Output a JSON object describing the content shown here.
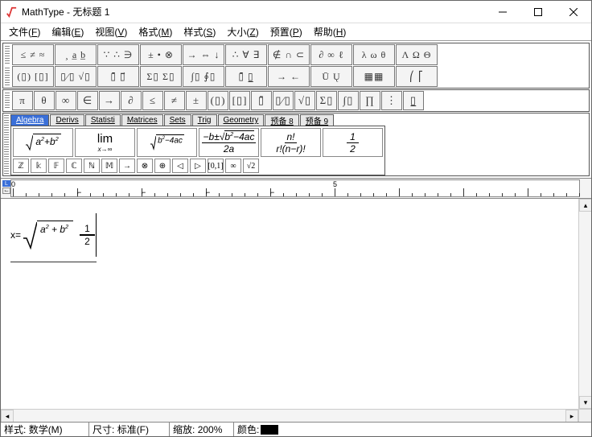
{
  "window": {
    "app": "MathType",
    "title": "无标题 1"
  },
  "menu": [
    {
      "label": "文件",
      "hotkey": "F"
    },
    {
      "label": "编辑",
      "hotkey": "E"
    },
    {
      "label": "视图",
      "hotkey": "V"
    },
    {
      "label": "格式",
      "hotkey": "M"
    },
    {
      "label": "样式",
      "hotkey": "S"
    },
    {
      "label": "大小",
      "hotkey": "Z"
    },
    {
      "label": "预置",
      "hotkey": "P"
    },
    {
      "label": "帮助",
      "hotkey": "H"
    }
  ],
  "palette_row1": [
    "≤ ≠ ≈",
    "¸ a̲ b̲",
    "∵ ∴ ∋",
    "± • ⊗",
    "→ ⇔ ↓",
    "∴ ∀ ∃",
    "∉ ∩ ⊂",
    "∂ ∞ ℓ",
    "λ ω θ",
    "Λ Ω Θ"
  ],
  "palette_row1b": [
    "(▯) [▯]",
    "▯⁄▯ √▯",
    "▯̄ ▯⃗",
    "Σ▯ Σ▯",
    "∫▯ ∮▯",
    "▯̄ ▯̲",
    "→ ←",
    "Ū Ų",
    "▦▦",
    "⎛ ⎡"
  ],
  "palette_row2": [
    "π",
    "θ",
    "∞",
    "∈",
    "→",
    "∂",
    "≤",
    "≠",
    "±",
    "(▯)",
    "[▯]",
    "▯̄",
    "▯⁄▯",
    "√▯",
    "Σ▯",
    "∫▯",
    "∏",
    "⋮",
    "▯̲"
  ],
  "tabs": [
    "Algebra",
    "Derivs",
    "Statisti",
    "Matrices",
    "Sets",
    "Trig",
    "Geometry",
    "预备 8",
    "预备 9"
  ],
  "active_tab": 0,
  "templates_big": [
    "sqrt_ab",
    "lim",
    "sqrt_disc",
    "quad",
    "combin",
    "half"
  ],
  "templates_small": [
    "ℤ",
    "𝕜",
    "𝔽",
    "ℂ",
    "ℕ",
    "𝕄",
    "→",
    "⊗",
    "⊕",
    "◁",
    "▷",
    "[0,1]",
    "∞",
    "√2"
  ],
  "ruler": {
    "marks": [
      "0",
      "5"
    ],
    "tabs_at": [
      1,
      2,
      3,
      4
    ]
  },
  "equation": {
    "lhs": "x=",
    "sqrt_a": "a",
    "sqrt_b": "b",
    "frac_num": "1",
    "frac_den": "2"
  },
  "status": {
    "style_label": "样式:",
    "style_value": "数学(M)",
    "size_label": "尺寸:",
    "size_value": "标准(F)",
    "zoom_label": "缩放:",
    "zoom_value": "200%",
    "color_label": "颜色:"
  }
}
